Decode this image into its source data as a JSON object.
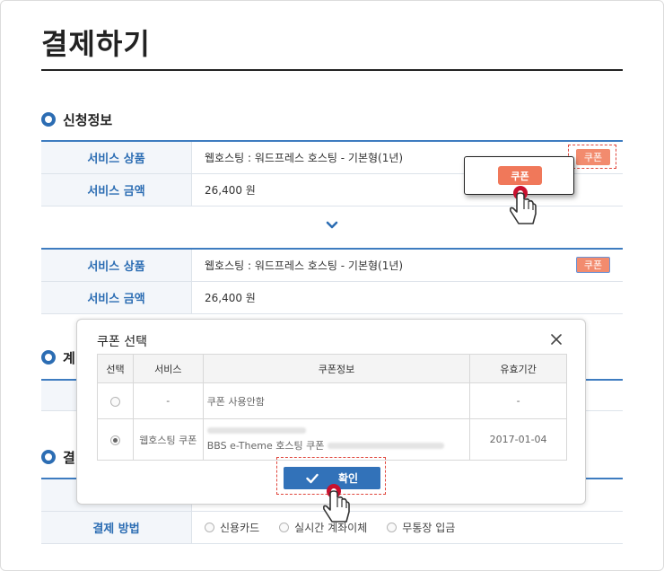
{
  "page": {
    "title": "결제하기"
  },
  "sections": {
    "apply_info": {
      "title": "신청정보"
    },
    "account": {
      "title": "계"
    },
    "payment": {
      "title": "결"
    }
  },
  "apply_table": {
    "row1_label": "서비스 상품",
    "row1_value": "웹호스팅 : 워드프레스 호스팅 - 기본형(1년)",
    "row2_label": "서비스 금액",
    "row2_value": "26,400 원",
    "coupon_label": "쿠폰"
  },
  "callout": {
    "button_label": "쿠폰"
  },
  "result_table": {
    "row1_label": "서비스 상품",
    "row1_value": "웹호스팅 : 워드프레스 호스팅 - 기본형(1년)",
    "row2_label": "서비스 금액",
    "row2_value": "26,400 원",
    "coupon_label": "쿠폰"
  },
  "modal": {
    "title": "쿠폰 선택",
    "columns": [
      "선택",
      "서비스",
      "쿠폰정보",
      "유효기간"
    ],
    "rows": [
      {
        "selected": false,
        "service": "-",
        "info": "쿠폰 사용안함",
        "info_extra": "",
        "valid": "-"
      },
      {
        "selected": true,
        "service": "웹호스팅 쿠폰",
        "info": "BBS e-Theme 호스팅 쿠폰",
        "info_extra": "",
        "valid": "2017-01-04"
      }
    ],
    "confirm_label": "확인"
  },
  "payment": {
    "method_label": "결제 방법",
    "options": [
      "신용카드",
      "실시간 계좌이체",
      "무통장 입금"
    ]
  },
  "colors": {
    "accent": "#2c6db3",
    "coupon": "#f28b6e",
    "highlight": "#e0463c",
    "confirm": "#3272b9"
  }
}
